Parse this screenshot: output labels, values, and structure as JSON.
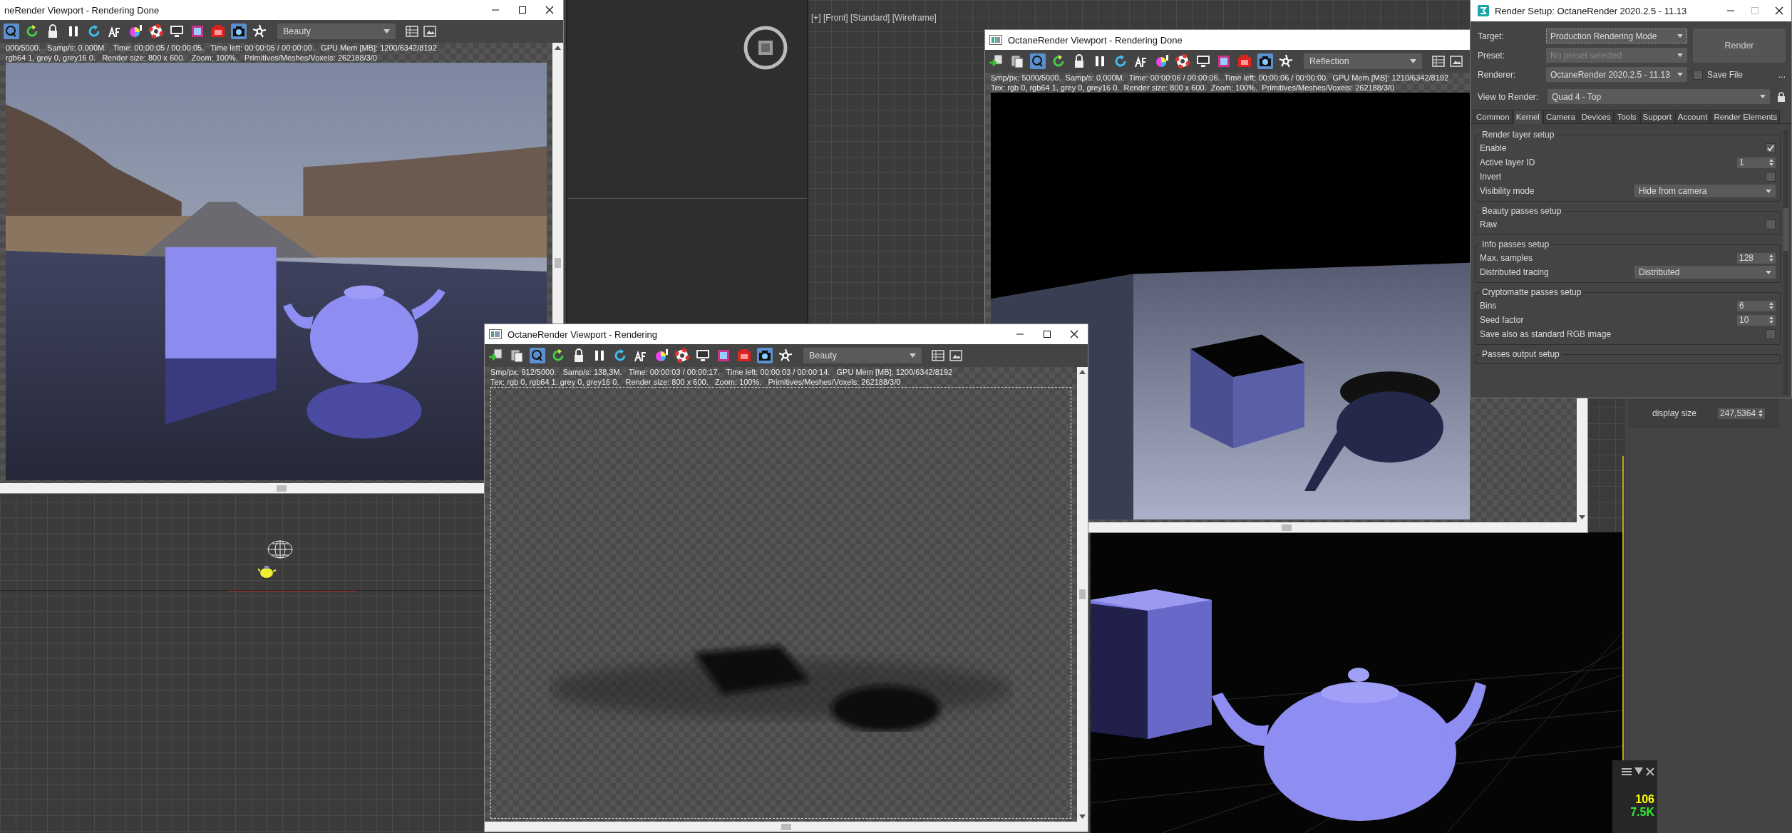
{
  "viewport_label": "[+] [Front] [Standard] [Wireframe]",
  "render_windows": [
    {
      "title": "neRender Viewport - Rendering Done",
      "pass": "Beauty",
      "status_lines": [
        "000/5000.   Samp/s: 0,000M.   Time: 00:00:05 / 00:00:05.   Time left: 00:00:05 / 00:00:00.   GPU Mem [MB]: 1200/6342/8192",
        "rgb64 1, grey 0, grey16 0.   Render size: 800 x 600.   Zoom: 100%.   Primitives/Meshes/Voxels: 262188/3/0"
      ],
      "kind": "scene"
    },
    {
      "title": "OctaneRender Viewport - Rendering",
      "pass": "Beauty",
      "status_lines": [
        "Smp/px: 912/5000.   Samp/s: 138,3M.   Time: 00:00:03 / 00:00:17.   Time left: 00:00:03 / 00:00:14.   GPU Mem [MB]: 1200/6342/8192",
        "Tex: rgb 0, rgb64 1, grey 0, grey16 0.   Render size: 800 x 600.   Zoom: 100%.   Primitives/Meshes/Voxels: 262188/3/0"
      ],
      "kind": "shadow"
    },
    {
      "title": "OctaneRender Viewport - Rendering Done",
      "pass": "Reflection",
      "status_lines": [
        "Smp/px: 5000/5000.  Samp/s: 0,000M.  Time: 00:00:06 / 00:00:06.  Time left: 00:00:06 / 00:00:00.  GPU Mem [MB]: 1210/6342/8192",
        "Tex: rgb 0, rgb64 1, grey 0, grey16 0.  Render size: 800 x 600.  Zoom: 100%.  Primitives/Meshes/Voxels: 262188/3/0"
      ],
      "kind": "reflection"
    }
  ],
  "render_setup": {
    "title": "Render Setup: OctaneRender 2020.2.5 - 11.13",
    "target": {
      "label": "Target:",
      "value": "Production Rendering Mode"
    },
    "preset": {
      "label": "Preset:",
      "placeholder": "No preset selected"
    },
    "renderer": {
      "label": "Renderer:",
      "value": "OctaneRender 2020.2.5 - 11.13"
    },
    "view": {
      "label": "View to Render:",
      "value": "Quad 4 - Top"
    },
    "render_button": "Render",
    "save_file": {
      "label": "Save File",
      "checked": false
    },
    "more": "...",
    "tabs": [
      {
        "label": "Common",
        "selected": false
      },
      {
        "label": "Kernel",
        "selected": true
      },
      {
        "label": "Camera",
        "selected": false
      },
      {
        "label": "Devices",
        "selected": false
      },
      {
        "label": "Tools",
        "selected": false
      },
      {
        "label": "Support",
        "selected": false
      },
      {
        "label": "Account",
        "selected": false
      },
      {
        "label": "Render Elements",
        "selected": false
      }
    ],
    "groups": [
      {
        "title": "Render layer setup",
        "rows": [
          {
            "kind": "checkbox",
            "label": "Enable",
            "checked": true
          },
          {
            "kind": "spinner",
            "label": "Active layer ID",
            "value": "1"
          },
          {
            "kind": "checkbox",
            "label": "Invert",
            "checked": false
          },
          {
            "kind": "dropdown",
            "label": "Visibility mode",
            "value": "Hide from camera"
          }
        ]
      },
      {
        "title": "Beauty passes setup",
        "rows": [
          {
            "kind": "checkbox",
            "label": "Raw",
            "checked": false
          }
        ]
      },
      {
        "title": "Info passes setup",
        "rows": [
          {
            "kind": "spinner",
            "label": "Max. samples",
            "value": "128"
          },
          {
            "kind": "dropdown",
            "label": "Distributed tracing",
            "value": "Distributed"
          }
        ]
      },
      {
        "title": "Cryptomatte passes setup",
        "rows": [
          {
            "kind": "spinner",
            "label": "Bins",
            "value": "6"
          },
          {
            "kind": "spinner",
            "label": "Seed factor",
            "value": "10"
          },
          {
            "kind": "checkbox",
            "label": "Save also as standard RGB image",
            "checked": false
          }
        ]
      },
      {
        "title": "Passes output setup"
      }
    ]
  },
  "display_size": {
    "label": "display size",
    "value": "247,5364"
  },
  "stats": [
    {
      "value": "106",
      "color": "#ffff00"
    },
    {
      "value": "7.5K",
      "color": "#33ee33"
    }
  ]
}
